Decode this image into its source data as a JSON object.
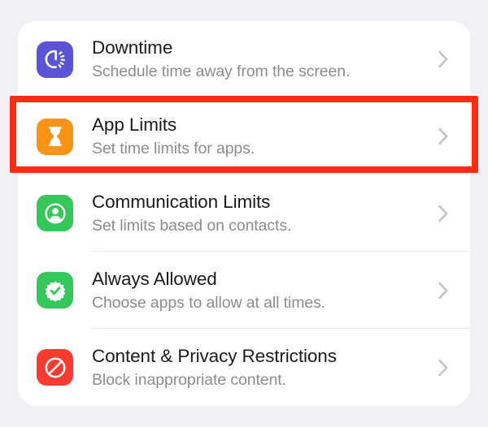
{
  "screen": {
    "name": "screen-time-settings",
    "background_color": "#f1f1f5",
    "card_background_color": "#ffffff"
  },
  "annotation": {
    "type": "highlight-box",
    "color": "#fc2d13",
    "target_row": "App Limits",
    "border_width_px": 8
  },
  "settings_list": {
    "rows": [
      {
        "title": "Downtime",
        "subtitle": "Schedule time away from the screen.",
        "icon": "downtime-icon",
        "icon_color": "#5a55d6",
        "chevron": "chevron-right-icon",
        "highlighted": false
      },
      {
        "title": "App Limits",
        "subtitle": "Set time limits for apps.",
        "icon": "hourglass-icon",
        "icon_color": "#fa9316",
        "chevron": "chevron-right-icon",
        "highlighted": true
      },
      {
        "title": "Communication Limits",
        "subtitle": "Set limits based on contacts.",
        "icon": "person-circle-icon",
        "icon_color": "#34c759",
        "chevron": "chevron-right-icon",
        "highlighted": false
      },
      {
        "title": "Always Allowed",
        "subtitle": "Choose apps to allow at all times.",
        "icon": "checkmark-rosette-icon",
        "icon_color": "#34c759",
        "chevron": "chevron-right-icon",
        "highlighted": false
      },
      {
        "title": "Content & Privacy Restrictions",
        "subtitle": "Block inappropriate content.",
        "icon": "prohibition-icon",
        "icon_color": "#fa3b30",
        "chevron": "chevron-right-icon",
        "highlighted": false
      }
    ]
  }
}
